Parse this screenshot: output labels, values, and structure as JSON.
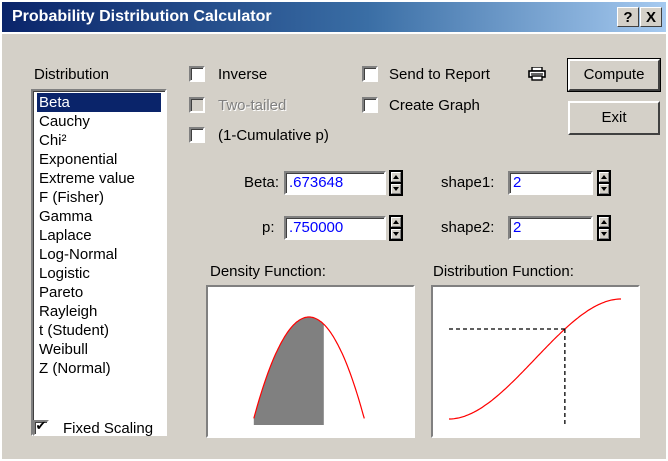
{
  "window": {
    "title": "Probability Distribution Calculator",
    "help_label": "?",
    "close_label": "X"
  },
  "distribution": {
    "label": "Distribution",
    "items": [
      "Beta",
      "Cauchy",
      "Chi²",
      "Exponential",
      "Extreme value",
      "F (Fisher)",
      "Gamma",
      "Laplace",
      "Log-Normal",
      "Logistic",
      "Pareto",
      "Rayleigh",
      "t (Student)",
      "Weibull",
      "Z (Normal)"
    ],
    "selected": "Beta"
  },
  "options": {
    "inverse": {
      "label": "Inverse",
      "checked": false
    },
    "two_tailed": {
      "label": "Two-tailed",
      "checked": false,
      "disabled": true
    },
    "one_minus_cumulative": {
      "label": "(1-Cumulative p)",
      "checked": false
    },
    "send_to_report": {
      "label": "Send to Report",
      "checked": false
    },
    "create_graph": {
      "label": "Create Graph",
      "checked": false
    },
    "fixed_scaling": {
      "label": "Fixed Scaling",
      "checked": true
    }
  },
  "buttons": {
    "compute": "Compute",
    "exit": "Exit"
  },
  "params": {
    "beta": {
      "label": "Beta:",
      "value": ".673648"
    },
    "p": {
      "label": "p:",
      "value": ".750000"
    },
    "shape1": {
      "label": "shape1:",
      "value": "2"
    },
    "shape2": {
      "label": "shape2:",
      "value": "2"
    }
  },
  "graphs": {
    "density_label": "Density Function:",
    "distribution_label": "Distribution Function:"
  },
  "colors": {
    "curve": "#ff0000",
    "shaded_area": "#808080",
    "field_text": "#0000ff",
    "selection": "#0a246a"
  },
  "icons": {
    "send_to_report": "printer-icon"
  }
}
